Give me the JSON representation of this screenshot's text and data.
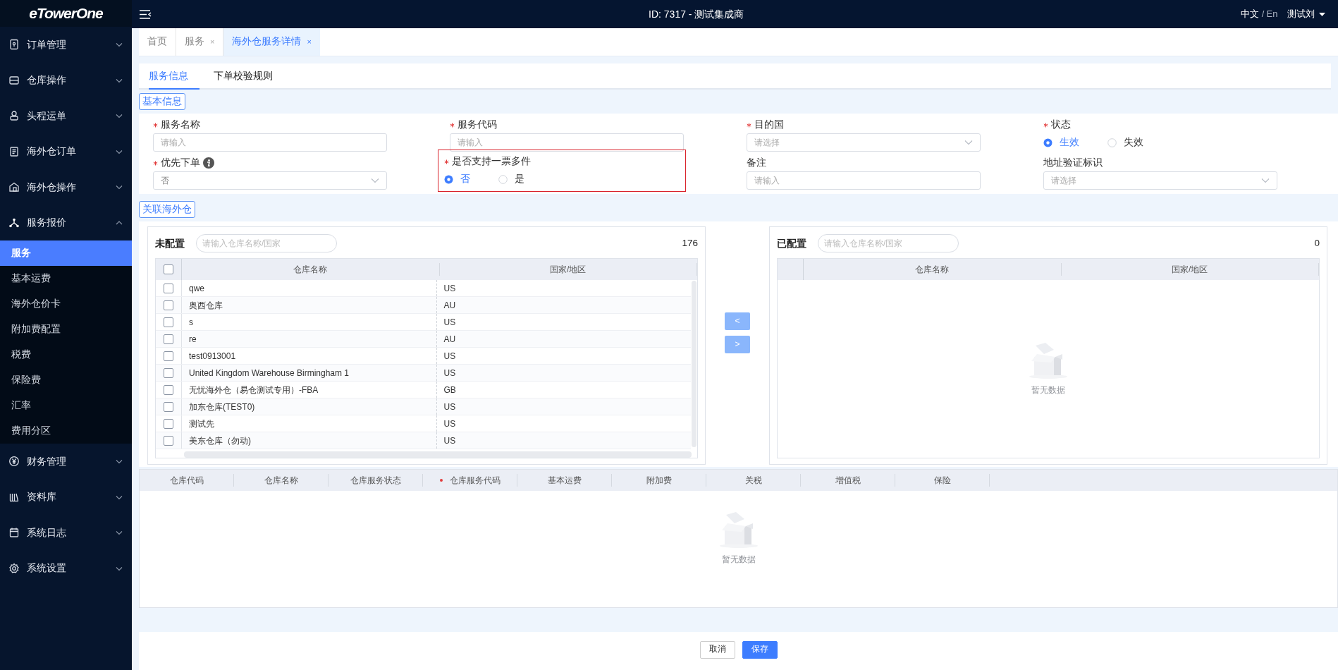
{
  "brand": {
    "logo": "eTowerOne"
  },
  "header": {
    "title": "ID: 7317 - 测试集成商",
    "separator": "/",
    "languages": [
      {
        "label": "中文",
        "selected": true
      },
      {
        "label": "En",
        "selected": false
      }
    ],
    "user": "测试刘"
  },
  "sidebar": {
    "items": [
      {
        "label": "订单管理",
        "expanded": false
      },
      {
        "label": "仓库操作",
        "expanded": false
      },
      {
        "label": "头程运单",
        "expanded": false
      },
      {
        "label": "海外仓订单",
        "expanded": false
      },
      {
        "label": "海外仓操作",
        "expanded": false
      },
      {
        "label": "服务报价",
        "expanded": true,
        "children": [
          {
            "label": "服务",
            "selected": true
          },
          {
            "label": "基本运费",
            "selected": false
          },
          {
            "label": "海外仓价卡",
            "selected": false
          },
          {
            "label": "附加费配置",
            "selected": false
          },
          {
            "label": "税费",
            "selected": false
          },
          {
            "label": "保险费",
            "selected": false
          },
          {
            "label": "汇率",
            "selected": false
          },
          {
            "label": "费用分区",
            "selected": false
          }
        ]
      },
      {
        "label": "财务管理",
        "expanded": false
      },
      {
        "label": "资料库",
        "expanded": false
      },
      {
        "label": "系统日志",
        "expanded": false
      },
      {
        "label": "系统设置",
        "expanded": false
      }
    ]
  },
  "tabs": [
    {
      "label": "首页",
      "selected": false
    },
    {
      "label": "服务",
      "selected": false,
      "close": "×"
    },
    {
      "label": "海外仓服务详情",
      "selected": true,
      "close": "×"
    }
  ],
  "subtabs": [
    {
      "label": "服务信息",
      "selected": true
    },
    {
      "label": "下单校验规则",
      "selected": false
    }
  ],
  "basic_info": {
    "heading": "基本信息",
    "fields": [
      {
        "label": "服务名称",
        "required": true,
        "kind": "input",
        "placeholder": "请输入"
      },
      {
        "label": "服务代码",
        "required": true,
        "kind": "input",
        "placeholder": "请输入"
      },
      {
        "label": "目的国",
        "required": true,
        "kind": "select",
        "placeholder": "请选择"
      },
      {
        "label": "状态",
        "required": true,
        "kind": "radio",
        "options": [
          {
            "label": "生效",
            "selected": true
          },
          {
            "label": "失效",
            "selected": false
          }
        ]
      },
      {
        "label": "优先下单",
        "required": true,
        "info": true,
        "kind": "select",
        "value": "否"
      },
      {
        "label": "是否支持一票多件",
        "required": true,
        "highlighted": true,
        "kind": "radio",
        "options": [
          {
            "label": "否",
            "selected": true
          },
          {
            "label": "是",
            "selected": false
          }
        ]
      },
      {
        "label": "备注",
        "required": false,
        "kind": "input",
        "placeholder": "请输入"
      },
      {
        "label": "地址验证标识",
        "required": false,
        "kind": "select",
        "placeholder": "请选择"
      }
    ]
  },
  "warehouses": {
    "heading": "关联海外仓",
    "unconfigured": {
      "title": "未配置",
      "search_placeholder": "请输入仓库名称/国家",
      "count": "176",
      "all_checked": false,
      "columns": [
        "仓库名称",
        "国家/地区"
      ],
      "rows": [
        {
          "name": "qwe",
          "country": "US",
          "checked": false
        },
        {
          "name": "奥西仓库",
          "country": "AU",
          "checked": false
        },
        {
          "name": "s",
          "country": "US",
          "checked": false
        },
        {
          "name": "re",
          "country": "AU",
          "checked": false
        },
        {
          "name": "test0913001",
          "country": "US",
          "checked": false
        },
        {
          "name": "United Kingdom Warehouse Birmingham 1",
          "country": "US",
          "checked": false
        },
        {
          "name": "无忧海外仓（易仓测试专用）-FBA",
          "country": "GB",
          "checked": false
        },
        {
          "name": "加东仓库(TEST0)",
          "country": "US",
          "checked": false
        },
        {
          "name": "测试先",
          "country": "US",
          "checked": false
        },
        {
          "name": "美东仓库（勿动)",
          "country": "US",
          "checked": false
        }
      ]
    },
    "transfer_buttons": [
      "<",
      ">"
    ],
    "configured": {
      "title": "已配置",
      "search_placeholder": "请输入仓库名称/国家",
      "count": "0",
      "columns": [
        "仓库名称",
        "国家/地区"
      ],
      "empty_text": "暂无数据"
    }
  },
  "services_table": {
    "columns": [
      {
        "label": "仓库代码",
        "required": false
      },
      {
        "label": "仓库名称",
        "required": false
      },
      {
        "label": "仓库服务状态",
        "required": false
      },
      {
        "label": "仓库服务代码",
        "required": true
      },
      {
        "label": "基本运费",
        "required": false
      },
      {
        "label": "附加费",
        "required": false
      },
      {
        "label": "关税",
        "required": false
      },
      {
        "label": "增值税",
        "required": false
      },
      {
        "label": "保险",
        "required": false
      }
    ],
    "empty_text": "暂无数据"
  },
  "footer": {
    "buttons": [
      {
        "label": "取消",
        "kind": "secondary"
      },
      {
        "label": "保存",
        "kind": "primary"
      }
    ]
  }
}
